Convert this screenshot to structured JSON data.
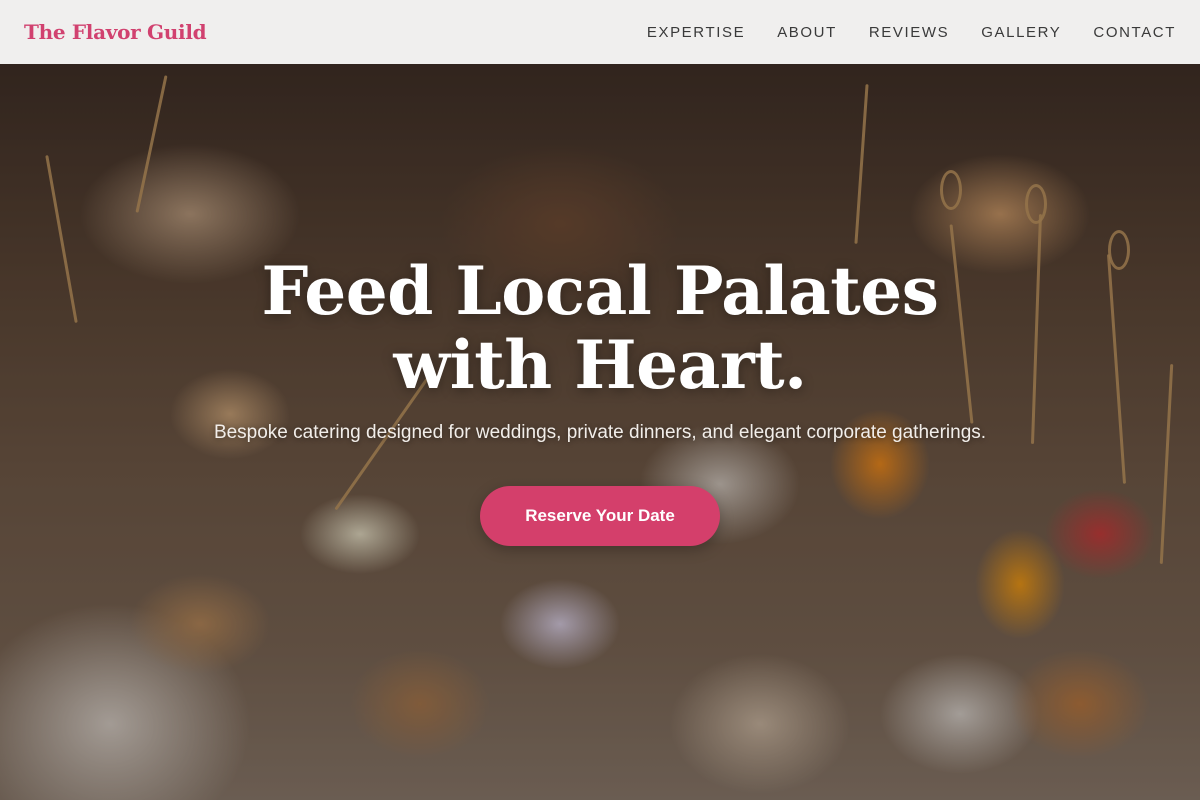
{
  "header": {
    "brand": "The Flavor Guild",
    "nav": [
      {
        "label": "EXPERTISE"
      },
      {
        "label": "ABOUT"
      },
      {
        "label": "REVIEWS"
      },
      {
        "label": "GALLERY"
      },
      {
        "label": "CONTACT"
      }
    ]
  },
  "hero": {
    "title": "Feed Local Palates with Heart.",
    "subtitle": "Bespoke catering designed for weddings, private dinners, and elegant corporate gatherings.",
    "cta_label": "Reserve Your Date"
  },
  "colors": {
    "brand": "#d1416f",
    "cta_background": "#d43f6b",
    "header_background": "#f7f6f5",
    "nav_text": "#3a3a3a"
  }
}
